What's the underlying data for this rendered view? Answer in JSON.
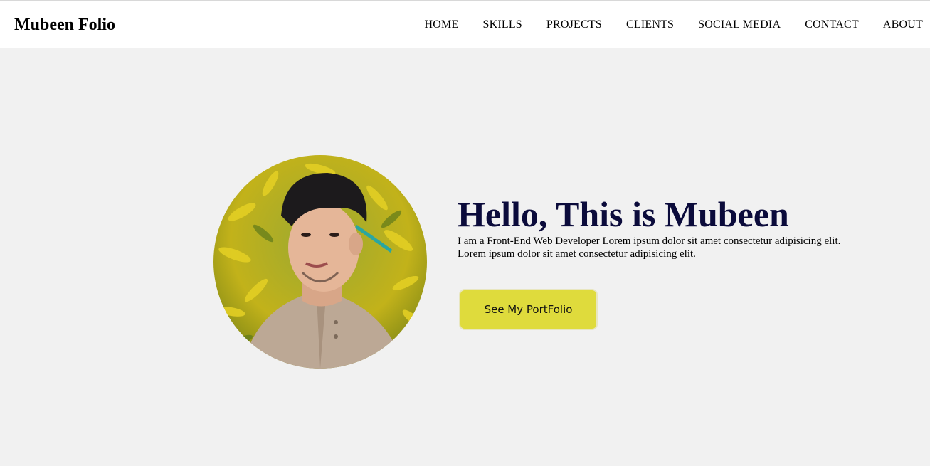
{
  "nav": {
    "brand": "Mubeen Folio",
    "links": [
      "HOME",
      "SKILLS",
      "PROJECTS",
      "CLIENTS",
      "SOCIAL MEDIA",
      "CONTACT",
      "ABOUT"
    ]
  },
  "hero": {
    "portrait_icon": "profile-photo",
    "headline": "Hello, This is Mubeen",
    "intro_line1": "I am a Front-End Web Developer Lorem ipsum dolor sit amet consectetur adipisicing elit.",
    "intro_line2": "Lorem ipsum dolor sit amet consectetur adipisicing elit.",
    "cta_label": "See My PortFolio"
  },
  "colors": {
    "background": "#f1f1f1",
    "navbar": "#ffffff",
    "headline": "#0b0b3b",
    "cta": "#dfdb3c"
  }
}
